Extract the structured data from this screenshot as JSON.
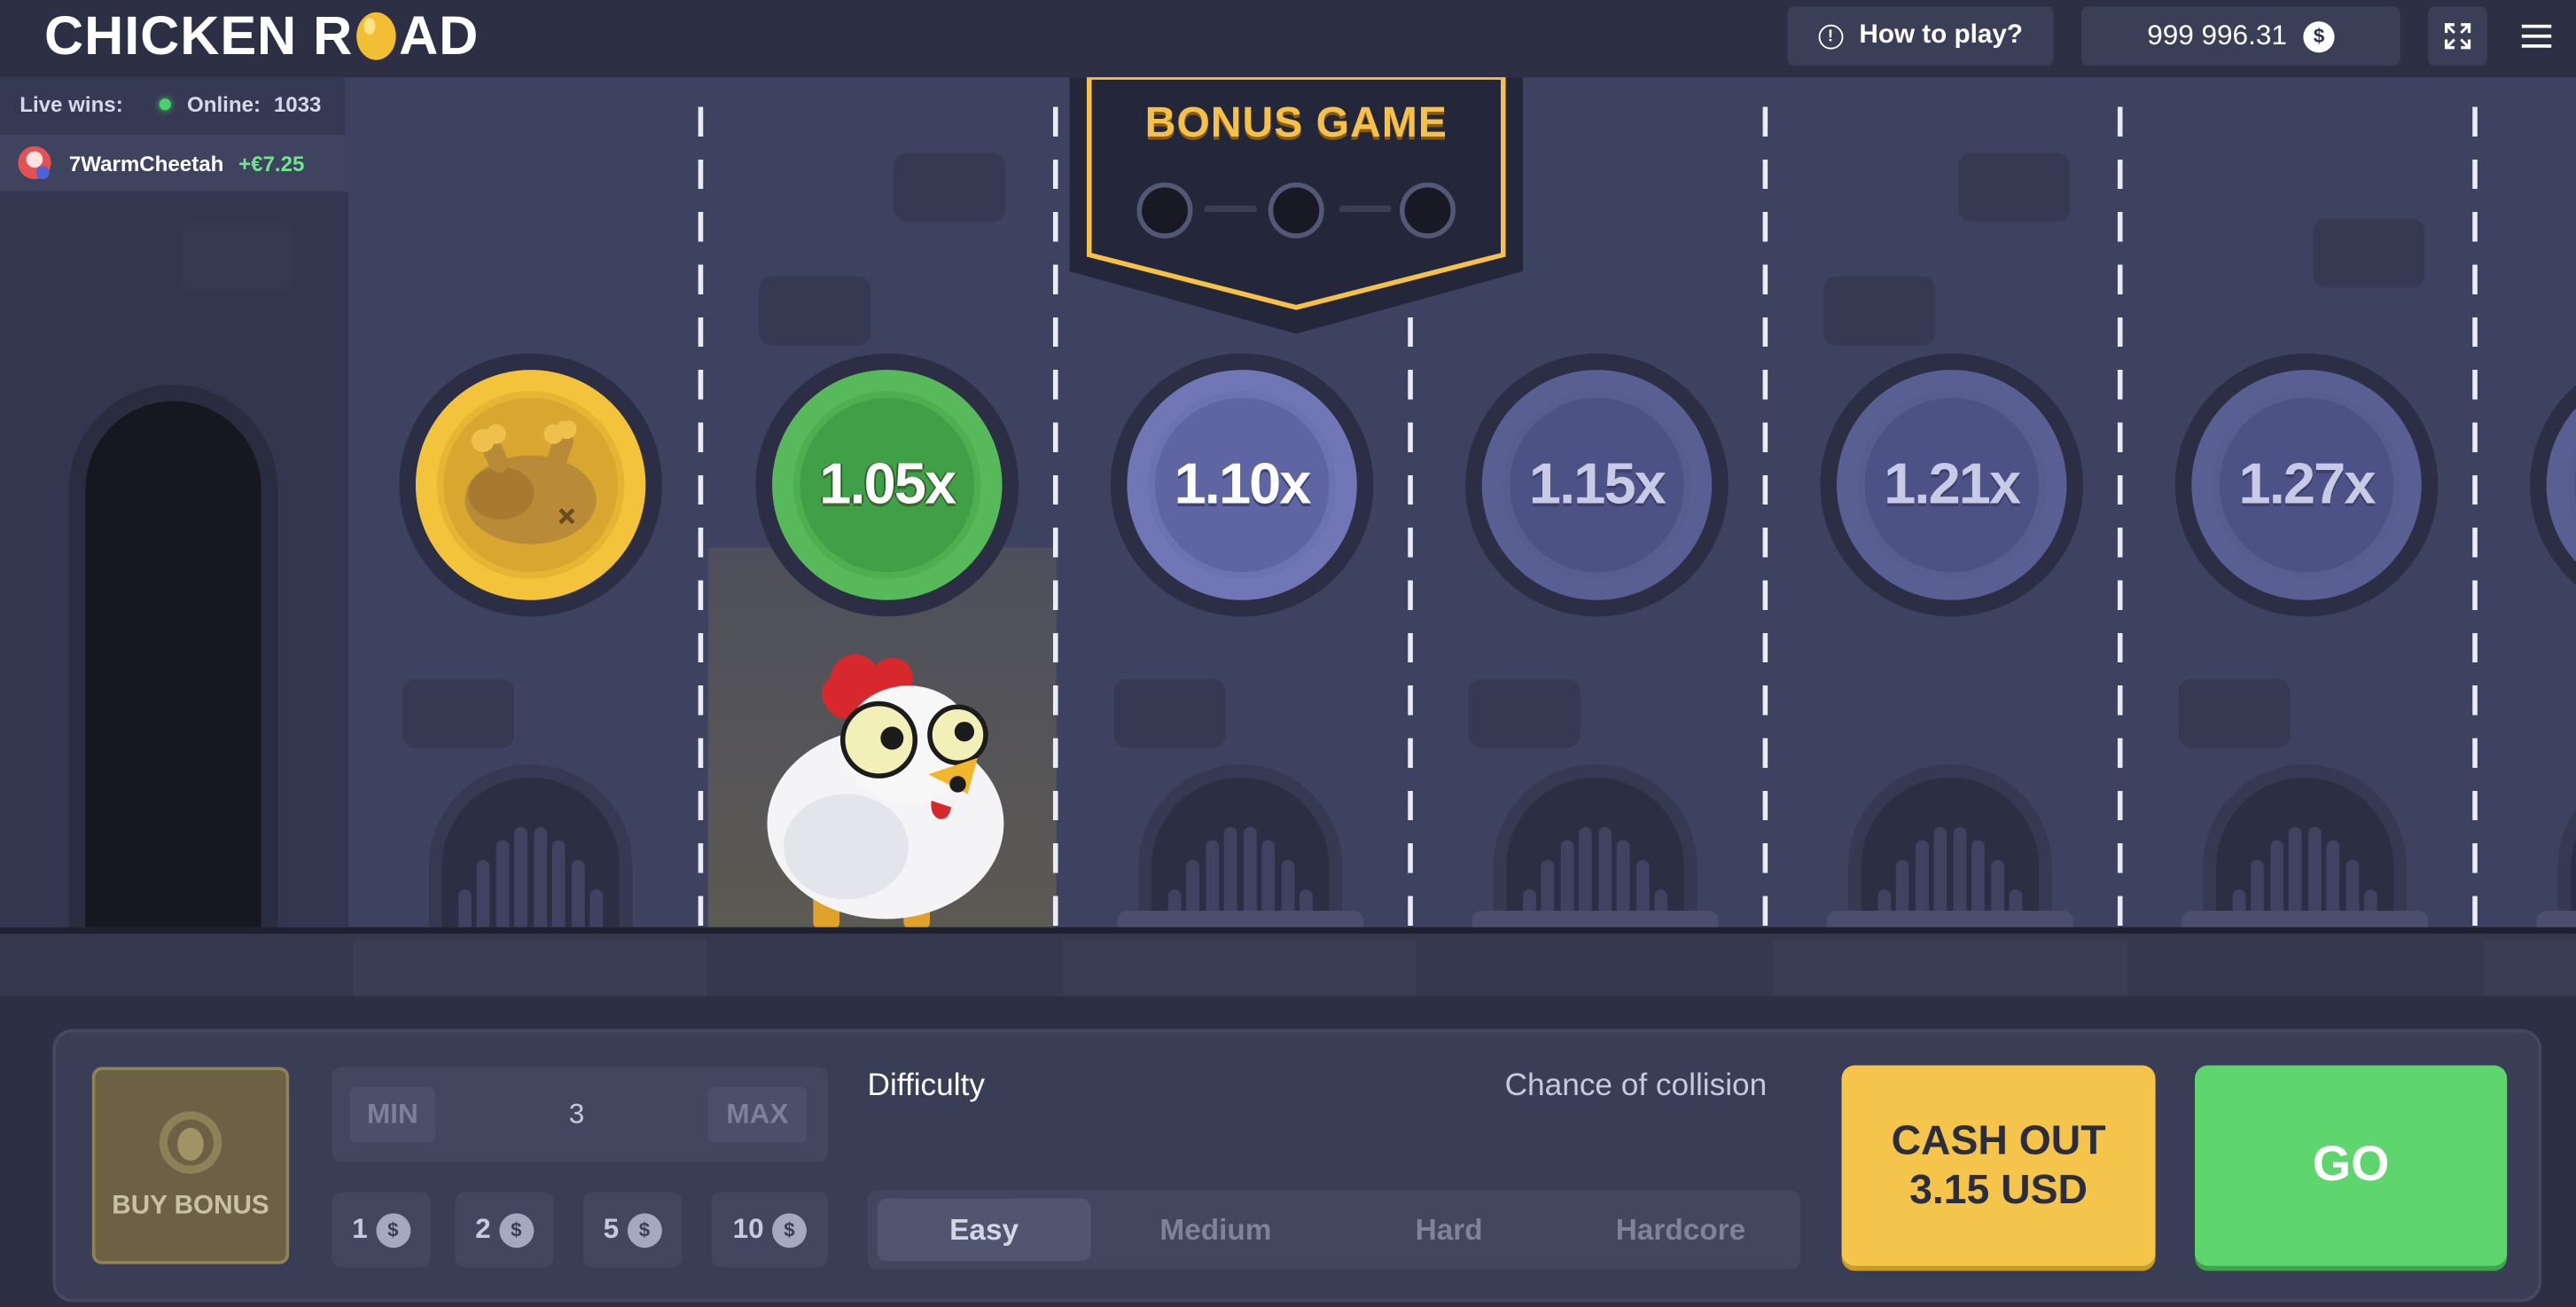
{
  "header": {
    "logo_part1": "CHICKEN R",
    "logo_part2": "AD",
    "how_to_play": "How to play?",
    "balance": "999 996.31",
    "currency_symbol": "$",
    "fullscreen_icon": "expand-icon",
    "menu_icon": "hamburger-menu-icon"
  },
  "live": {
    "live_wins_label": "Live wins:",
    "online_label": "Online:",
    "online_count": "1033",
    "wins": [
      {
        "name": "7WarmCheetah",
        "amount": "+€7.25"
      }
    ]
  },
  "board": {
    "bonus_title": "BONUS GAME",
    "bonus_progress": 0,
    "bonus_slots": 3,
    "multipliers": [
      {
        "label": "",
        "state": "collected",
        "icon": "roast-chicken-icon"
      },
      {
        "label": "1.05x",
        "state": "current"
      },
      {
        "label": "1.10x",
        "state": "next"
      },
      {
        "label": "1.15x",
        "state": "upcoming"
      },
      {
        "label": "1.21x",
        "state": "upcoming"
      },
      {
        "label": "1.27x",
        "state": "upcoming"
      }
    ],
    "chicken_lane": 2
  },
  "controls": {
    "buy_bonus": "BUY BONUS",
    "min": "MIN",
    "max": "MAX",
    "bet_value": "3",
    "quick_bets": [
      "1",
      "2",
      "5",
      "10"
    ],
    "quick_currency": "$",
    "difficulty_title": "Difficulty",
    "chance_title": "Chance of collision",
    "difficulties": [
      "Easy",
      "Medium",
      "Hard",
      "Hardcore"
    ],
    "selected_difficulty": "Easy",
    "cashout_line1": "CASH OUT",
    "cashout_line2": "3.15 USD",
    "go": "GO"
  },
  "colors": {
    "background": "#3e4261",
    "topbar": "#2d2f45",
    "cashout": "#f4c54a",
    "go": "#5fd56e",
    "online_dot": "#48d36a",
    "win_amount": "#6ee68c",
    "bonus_gold": "#f5c148"
  }
}
